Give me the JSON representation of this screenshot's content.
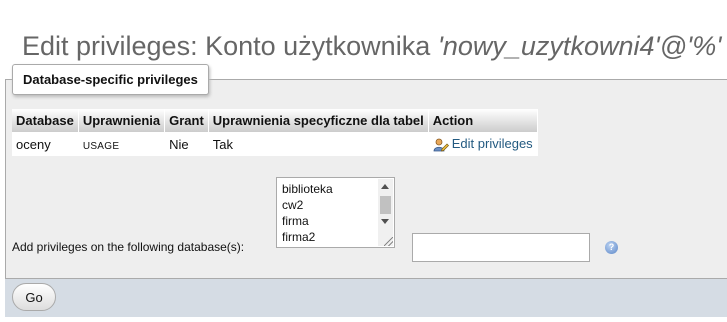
{
  "page": {
    "title_prefix": "Edit privileges: Konto użytkownika ",
    "title_user": "'nowy_uzytkowni4'@'%'"
  },
  "fieldset": {
    "legend": "Database-specific privileges"
  },
  "privileges_table": {
    "headers": [
      "Database",
      "Uprawnienia",
      "Grant",
      "Uprawnienia specyficzne dla tabel",
      "Action"
    ],
    "rows": [
      {
        "database": "oceny",
        "privileges": "USAGE",
        "grant": "Nie",
        "table_specific": "Tak",
        "action_label": "Edit privileges",
        "action_icon": "edit-user-icon"
      }
    ]
  },
  "add_privileges": {
    "label": "Add privileges on the following database(s):",
    "options": [
      "biblioteka",
      "cw2",
      "firma",
      "firma2"
    ],
    "input_value": "",
    "help_icon": "help-icon"
  },
  "footer": {
    "go_label": "Go"
  }
}
